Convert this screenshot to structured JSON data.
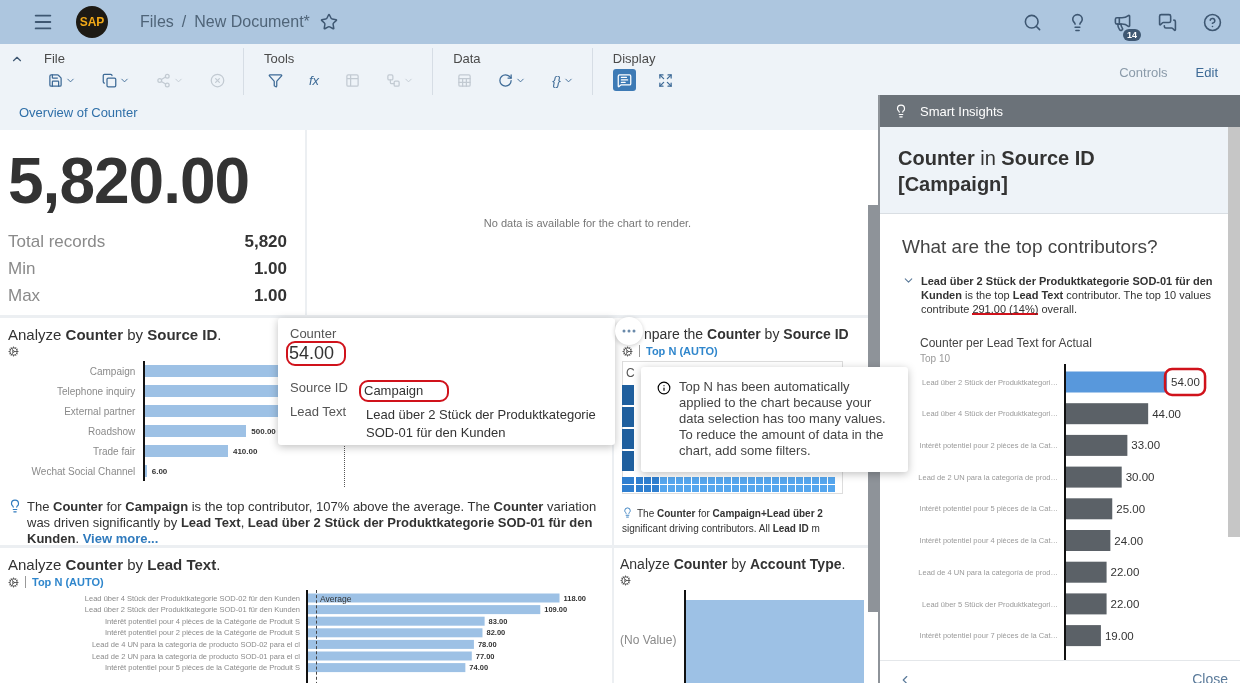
{
  "shell": {
    "logo": "SAP",
    "title": "Files",
    "separator": "/",
    "document": "New Document*",
    "favorite": false,
    "badge": "14"
  },
  "toolbar": {
    "collapsed": false,
    "groups": [
      {
        "label": "File",
        "items": [
          {
            "has_menu": true,
            "disabled": false,
            "selected": false
          },
          {
            "has_menu": true,
            "disabled": false,
            "selected": false
          },
          {
            "has_menu": true,
            "disabled": true,
            "selected": false
          },
          {
            "has_menu": false,
            "disabled": true,
            "selected": false
          }
        ]
      },
      {
        "label": "Tools",
        "items": [
          {
            "has_menu": false,
            "disabled": false,
            "selected": false
          },
          {
            "has_menu": false,
            "disabled": false,
            "selected": false,
            "text": "fx"
          },
          {
            "has_menu": false,
            "disabled": true,
            "selected": false
          },
          {
            "has_menu": true,
            "disabled": true,
            "selected": false
          }
        ]
      },
      {
        "label": "Data",
        "items": [
          {
            "has_menu": false,
            "disabled": true,
            "selected": false
          },
          {
            "has_menu": true,
            "disabled": false,
            "selected": false
          },
          {
            "has_menu": true,
            "disabled": false,
            "selected": false,
            "text": "{}"
          }
        ]
      },
      {
        "label": "Display",
        "items": [
          {
            "has_menu": false,
            "disabled": false,
            "selected": true
          },
          {
            "has_menu": false,
            "disabled": false,
            "selected": false
          }
        ]
      }
    ],
    "actions": [
      {
        "label": "Controls",
        "disabled": true
      },
      {
        "label": "Edit",
        "disabled": false
      }
    ]
  },
  "page_tab": "Overview of Counter",
  "kpi_tile": {
    "value": "5,820.00",
    "stats": [
      {
        "label": "Total records",
        "value": "5,820"
      },
      {
        "label": "Min",
        "value": "1.00"
      },
      {
        "label": "Max",
        "value": "1.00"
      }
    ]
  },
  "empty_tile": {
    "message": "No data is available for the chart to render."
  },
  "source_tile": {
    "title": "Analyze **Counter** by **Source ID**.",
    "average": {
      "level": 0.43
    },
    "bars": [
      {
        "label": "Campaign",
        "level": 0.9
      },
      {
        "label": "Telephone inquiry",
        "level": 0.84
      },
      {
        "label": "External partner",
        "level": 0.8
      },
      {
        "label": "Roadshow",
        "level": 0.22,
        "value": "500.00"
      },
      {
        "label": "Trade fair",
        "level": 0.18,
        "value": "410.00"
      },
      {
        "label": "Wechat Social Channel",
        "level": 0.003,
        "value": "6.00"
      }
    ],
    "insight": "The **Counter** for **Campaign** is the top contributor, 107% above the average. The **Counter** variation was driven significantly by **Lead Text**, **Lead über 2 Stück der Produktkategorie SOD-01 für den Kunden**.",
    "link": "View more..."
  },
  "compare_tile": {
    "title": "npare the **Counter** by **Source ID**",
    "top_n": "Top N (AUTO)",
    "legend_text": "C",
    "insight_lines": [
      "The **Counter** for **Campaign+Lead über 2**",
      "significant driving contributors. All **Lead ID** m"
    ]
  },
  "lead_tile": {
    "title": "Analyze **Counter** by **Lead Text**.",
    "top_n": "Top N (AUTO)",
    "chart_data": {
      "type": "bar",
      "orientation": "horizontal",
      "categories": [
        "Lead über 4 Stück der Produktkategorie SOD-02 für den Kunden",
        "Lead über 2 Stück der Produktkategorie SOD-01 für den Kunden",
        "Intérêt potentiel pour 4 pièces de la Catégorie de Produit S",
        "Intérêt potentiel pour 2 pièces de la Catégorie de Produit S",
        "Lead de 4 UN para la categoría de producto SOD-02 para el cl",
        "Lead de 2 UN para la categoría de producto SOD-01 para el cl",
        "Intérêt potentiel pour 5 pièces de la Catégorie de Produit S"
      ],
      "series": [
        {
          "color": "#9dc1e5",
          "values": [
            118,
            109,
            83,
            82,
            78,
            77,
            74
          ],
          "value_labels": [
            "118.00",
            "109.00",
            "83.00",
            "82.00",
            "78.00",
            "77.00",
            "74.00"
          ]
        }
      ]
    },
    "average": {
      "label": "Average"
    }
  },
  "account_tile": {
    "title": "Analyze **Counter** by **Account Type**.",
    "bars": [
      {
        "label": "(No Value)",
        "level": 1
      }
    ]
  },
  "tooltip": {
    "title": "Counter",
    "value": "54.00",
    "value_circled": true,
    "fields": [
      {
        "label": "Source ID",
        "value": "Campaign",
        "circled": true
      },
      {
        "label": "Lead Text",
        "value": "Lead über 2 Stück der Produktkategorie SOD-01 für den Kunden",
        "circled": false
      }
    ]
  },
  "info_popover": {
    "text": "Top N has been automatically applied to the chart because your data selection has too many values. To reduce the amount of data in the chart, add some filters."
  },
  "panel": {
    "header": "Smart Insights",
    "title": "**Counter** in **Source ID [Campaign]**",
    "question": "What are the top contributors?",
    "expanded": true,
    "summary_parts": [
      {
        "text": "**Lead über 2 Stück der Produktkategorie SOD-01 für den Kunden** is the top **Lead Text** contributor. The top 10 values contribute ",
        "underlined": false
      },
      {
        "text": "291.00 (14%)",
        "underlined": true
      },
      {
        "text": " overall.",
        "underlined": false
      }
    ],
    "chart_title": "Counter per Lead Text for Actual",
    "chart_subtitle": "Top 10",
    "value_label_circled": true,
    "chart_data": {
      "type": "bar",
      "orientation": "horizontal",
      "stacked": true,
      "categories": [
        "Lead über 2 Stück der Produktkategori…",
        "Lead über 4 Stück der Produktkategori…",
        "Intérêt potentiel pour 2 pièces de la Cat…",
        "Lead de 2 UN para la categoría de prod…",
        "Intérêt potentiel pour 5 pièces de la Cat…",
        "Intérêt potentiel pour 4 pièces de la Cat…",
        "Lead de 4 UN para la categoría de prod…",
        "Lead über 5 Stück der Produktkategori…",
        "Intérêt potentiel pour 7 pièces de la Cat…"
      ],
      "series": [
        {
          "color": "#5898dc",
          "values": [
            54,
            null,
            null,
            null,
            null,
            null,
            null,
            null,
            null
          ],
          "value_labels": [
            "54.00",
            null,
            null,
            null,
            null,
            null,
            null,
            null,
            null
          ]
        },
        {
          "color": "#5b6167",
          "values": [
            null,
            44,
            33,
            30,
            25,
            24,
            22,
            22,
            19
          ],
          "value_labels": [
            null,
            "44.00",
            "33.00",
            "30.00",
            "25.00",
            "24.00",
            "22.00",
            "22.00",
            "19.00"
          ]
        }
      ]
    },
    "close": "Close"
  }
}
